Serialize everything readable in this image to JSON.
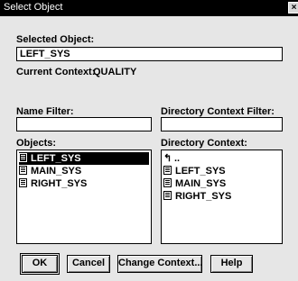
{
  "window": {
    "title": "Select Object",
    "close_glyph": "×"
  },
  "selected_object": {
    "label": "Selected Object:",
    "value": "LEFT_SYS"
  },
  "current_context": {
    "label": "Current Context:",
    "value": "QUALITY"
  },
  "name_filter": {
    "label": "Name Filter:",
    "value": ""
  },
  "directory_context_filter": {
    "label": "Directory Context Filter:",
    "value": ""
  },
  "objects": {
    "label": "Objects:",
    "items": [
      {
        "label": "LEFT_SYS",
        "icon": "object-icon",
        "selected": true
      },
      {
        "label": "MAIN_SYS",
        "icon": "object-icon",
        "selected": false
      },
      {
        "label": "RIGHT_SYS",
        "icon": "object-icon",
        "selected": false
      }
    ]
  },
  "directory_context": {
    "label": "Directory Context:",
    "up_item": {
      "label": "..",
      "icon": "parent-directory-icon"
    },
    "items": [
      {
        "label": "LEFT_SYS",
        "icon": "object-icon"
      },
      {
        "label": "MAIN_SYS",
        "icon": "object-icon"
      },
      {
        "label": "RIGHT_SYS",
        "icon": "object-icon"
      }
    ]
  },
  "buttons": {
    "ok": "OK",
    "cancel": "Cancel",
    "change_context": "Change Context...",
    "help": "Help"
  }
}
